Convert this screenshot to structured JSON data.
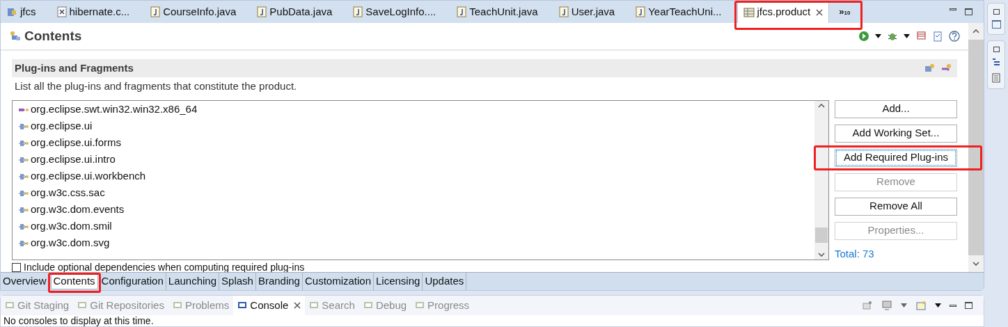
{
  "editor_tabs": [
    {
      "label": "jfcs",
      "kind": "project",
      "selected": false,
      "closable": false
    },
    {
      "label": "hibernate.c...",
      "kind": "xml",
      "selected": false,
      "closable": false
    },
    {
      "label": "CourseInfo.java",
      "kind": "java",
      "selected": false,
      "closable": false
    },
    {
      "label": "PubData.java",
      "kind": "java",
      "selected": false,
      "closable": false
    },
    {
      "label": "SaveLogInfo....",
      "kind": "java",
      "selected": false,
      "closable": false
    },
    {
      "label": "TeachUnit.java",
      "kind": "java",
      "selected": false,
      "closable": false
    },
    {
      "label": "User.java",
      "kind": "java",
      "selected": false,
      "closable": false
    },
    {
      "label": "YearTeachUni...",
      "kind": "java",
      "selected": false,
      "closable": false
    },
    {
      "label": "jfcs.product",
      "kind": "product",
      "selected": true,
      "closable": true
    }
  ],
  "overflow": {
    "symbol": "»",
    "count": "10"
  },
  "form": {
    "title": "Contents",
    "section": {
      "title": "Plug-ins and Fragments",
      "description": "List all the plug-ins and fragments that constitute the product.",
      "items": [
        {
          "label": "org.eclipse.swt.win32.win32.x86_64",
          "kind": "fragment"
        },
        {
          "label": "org.eclipse.ui",
          "kind": "plugin"
        },
        {
          "label": "org.eclipse.ui.forms",
          "kind": "plugin"
        },
        {
          "label": "org.eclipse.ui.intro",
          "kind": "plugin"
        },
        {
          "label": "org.eclipse.ui.workbench",
          "kind": "plugin"
        },
        {
          "label": "org.w3c.css.sac",
          "kind": "plugin"
        },
        {
          "label": "org.w3c.dom.events",
          "kind": "plugin"
        },
        {
          "label": "org.w3c.dom.smil",
          "kind": "plugin"
        },
        {
          "label": "org.w3c.dom.svg",
          "kind": "plugin"
        }
      ],
      "buttons": [
        {
          "label": "Add...",
          "disabled": false,
          "focused": false,
          "highlighted": false
        },
        {
          "label": "Add Working Set...",
          "disabled": false,
          "focused": false,
          "highlighted": false
        },
        {
          "label": "Add Required Plug-ins",
          "disabled": false,
          "focused": true,
          "highlighted": true
        },
        {
          "label": "Remove",
          "disabled": true,
          "focused": false,
          "highlighted": false
        },
        {
          "label": "Remove All",
          "disabled": false,
          "focused": false,
          "highlighted": false
        },
        {
          "label": "Properties...",
          "disabled": true,
          "focused": false,
          "highlighted": false
        }
      ],
      "total": "Total: 73",
      "checkbox": {
        "label": "Include optional dependencies when computing required plug-ins",
        "checked": false
      }
    }
  },
  "page_tabs": [
    {
      "label": "Overview",
      "selected": false
    },
    {
      "label": "Contents",
      "selected": true
    },
    {
      "label": "Configuration",
      "selected": false
    },
    {
      "label": "Launching",
      "selected": false
    },
    {
      "label": "Splash",
      "selected": false
    },
    {
      "label": "Branding",
      "selected": false
    },
    {
      "label": "Customization",
      "selected": false
    },
    {
      "label": "Licensing",
      "selected": false
    },
    {
      "label": "Updates",
      "selected": false
    }
  ],
  "views": [
    {
      "label": "Git Staging",
      "selected": false,
      "closable": false
    },
    {
      "label": "Git Repositories",
      "selected": false,
      "closable": false
    },
    {
      "label": "Problems",
      "selected": false,
      "closable": false
    },
    {
      "label": "Console",
      "selected": true,
      "closable": true
    },
    {
      "label": "Search",
      "selected": false,
      "closable": false
    },
    {
      "label": "Debug",
      "selected": false,
      "closable": false
    },
    {
      "label": "Progress",
      "selected": false,
      "closable": false
    }
  ],
  "console_message": "No consoles to display at this time."
}
